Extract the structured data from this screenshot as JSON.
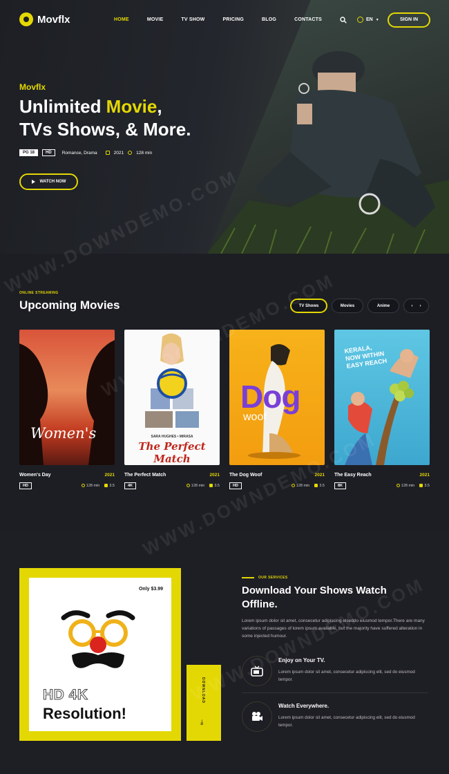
{
  "brand": {
    "name": "Movflx"
  },
  "nav": {
    "items": [
      "HOME",
      "MOVIE",
      "TV SHOW",
      "PRICING",
      "BLOG",
      "CONTACTS"
    ],
    "lang": "EN",
    "signin": "SIGN IN"
  },
  "hero": {
    "kicker": "Movflx",
    "title_line1_a": "Unlimited ",
    "title_line1_b": "Movie",
    "title_line1_c": ",",
    "title_line2": "TVs Shows, & More.",
    "rating": "PG 18",
    "quality": "HD",
    "genres": "Romance, Drama",
    "year": "2021",
    "duration": "128 min",
    "watch": "WATCH NOW"
  },
  "upcoming": {
    "kicker": "ONLINE STREAMING",
    "title": "Upcoming Movies",
    "filters": [
      "TV Shows",
      "Movies",
      "Anime"
    ],
    "movies": [
      {
        "title": "Women's Day",
        "year": "2021",
        "quality": "HD",
        "duration": "128 min",
        "rating": "3.5",
        "poster_text": "Women's"
      },
      {
        "title": "The Perfect Match",
        "year": "2021",
        "quality": "4K",
        "duration": "128 min",
        "rating": "3.5",
        "poster_text": "The Perfect Match",
        "poster_sub": "SARA HUGHES • MIRASA"
      },
      {
        "title": "The Dog Woof",
        "year": "2021",
        "quality": "HD",
        "duration": "128 min",
        "rating": "3.5",
        "poster_text": "Dog",
        "poster_sub": "woof"
      },
      {
        "title": "The Easy Reach",
        "year": "2021",
        "quality": "8K",
        "duration": "128 min",
        "rating": "3.5",
        "poster_text": "KERALA, NOW WITHIN EASY REACH"
      }
    ]
  },
  "services": {
    "price": "Only $3.99",
    "promo_line1": "HD 4K",
    "promo_line2": "Resolution!",
    "download": "DOWNLOAD",
    "kicker": "OUR SERVICES",
    "title": "Download Your Shows Watch Offline.",
    "description": "Lorem ipsum dolor sit amet, consecetur adipiscing elseddo eiusmod tempor.There are many variations of passages of lorem ipsum available, but the majority have suffered alteration in some injected humour.",
    "features": [
      {
        "title": "Enjoy on Your TV.",
        "desc": "Lorem ipsum dolor sit amet, consecetur adipiscing elit, sed do eiusmod tempor."
      },
      {
        "title": "Watch Everywhere.",
        "desc": "Lorem ipsum dolor sit amet, consecetur adipiscing elit, sed do eiusmod tempor."
      }
    ]
  },
  "watermark": "WWW.DOWNDEMO.COM",
  "colors": {
    "accent": "#e4d804",
    "background": "#1b1b22"
  }
}
